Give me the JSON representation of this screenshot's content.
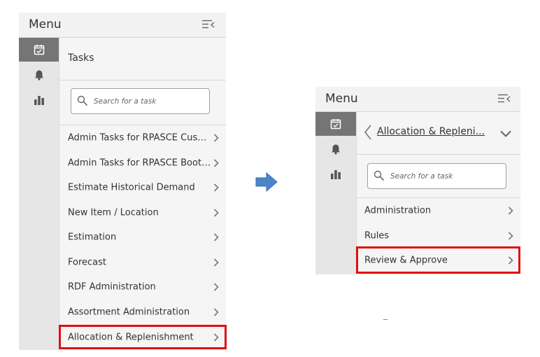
{
  "left_panel": {
    "menu_title": "Menu",
    "section_title": "Tasks",
    "search_placeholder": "Search for a task",
    "items": [
      {
        "label": "Admin Tasks for RPASCE Custom..."
      },
      {
        "label": "Admin Tasks for RPASCE Bootstra..."
      },
      {
        "label": "Estimate Historical Demand"
      },
      {
        "label": "New Item / Location"
      },
      {
        "label": "Estimation"
      },
      {
        "label": "Forecast"
      },
      {
        "label": "RDF Administration"
      },
      {
        "label": "Assortment Administration"
      },
      {
        "label": "Allocation & Replenishment"
      }
    ],
    "highlighted_item": "Allocation & Replenishment"
  },
  "right_panel": {
    "menu_title": "Menu",
    "section_title": "Allocation & Repleni...",
    "search_placeholder": "Search for a task",
    "items": [
      {
        "label": "Administration"
      },
      {
        "label": "Rules"
      },
      {
        "label": "Review & Approve"
      }
    ],
    "highlighted_item": "Review & Approve"
  },
  "colors": {
    "highlight": "#e01010",
    "arrow": "#4a86c8",
    "rail_active": "#757575"
  },
  "icons": [
    "collapse-menu-icon",
    "calendar-check-icon",
    "bell-icon",
    "bar-chart-icon",
    "search-icon",
    "chevron-right-icon",
    "chevron-left-icon",
    "chevron-down-icon",
    "right-arrow-icon"
  ]
}
